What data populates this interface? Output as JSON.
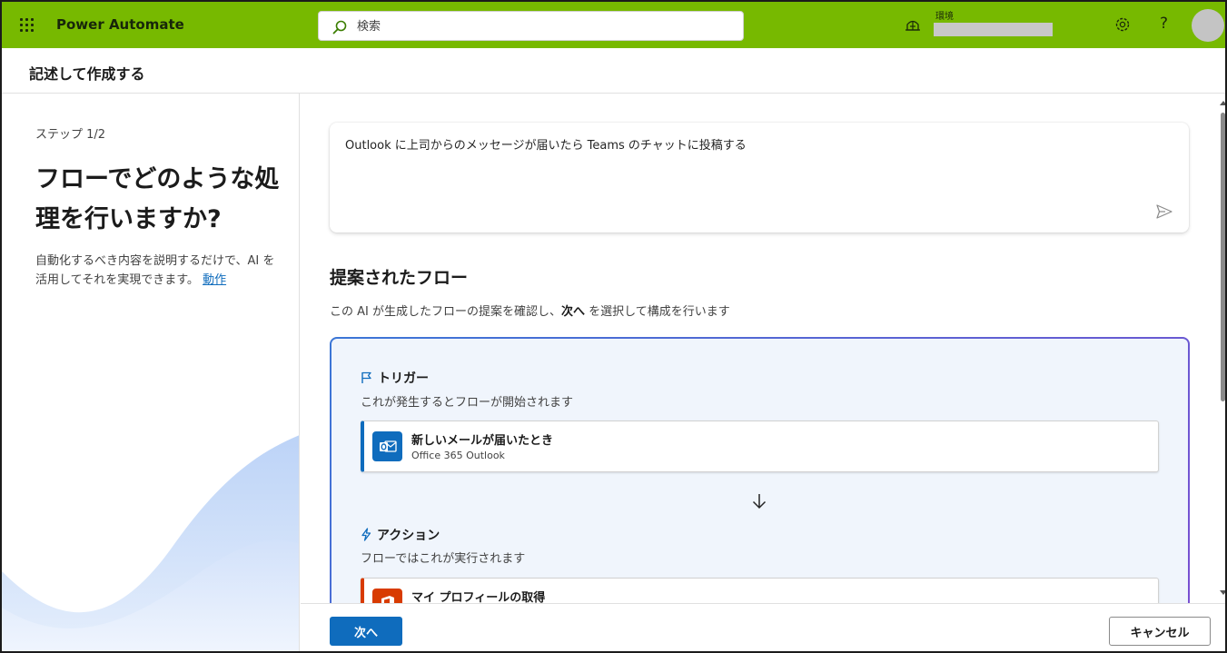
{
  "header": {
    "app_name": "Power Automate",
    "search_placeholder": "検索",
    "environment_label": "環境",
    "brand_color": "#77b900",
    "icons": [
      "waffle-icon",
      "search-icon",
      "environment-icon",
      "settings-gear-icon",
      "help-icon",
      "avatar"
    ]
  },
  "page": {
    "title": "記述して作成する"
  },
  "left_panel": {
    "step": "ステップ 1/2",
    "heading": "フローでどのような処理を行いますか?",
    "description": "自動化するべき内容を説明するだけで、AI を活用してそれを実現できます。",
    "link": "動作"
  },
  "prompt": {
    "text": "Outlook に上司からのメッセージが届いたら Teams のチャットに投稿する"
  },
  "suggestion": {
    "title": "提案されたフロー",
    "subtitle_pre": "この AI が生成したフローの提案を確認し、",
    "subtitle_bold": "次へ",
    "subtitle_post": " を選択して構成を行います",
    "trigger": {
      "label": "トリガー",
      "description": "これが発生するとフローが開始されます",
      "step_name": "新しいメールが届いたとき",
      "app": "Office 365 Outlook"
    },
    "action": {
      "label": "アクション",
      "description": "フローではこれが実行されます",
      "step_name": "マイ プロフィールの取得"
    }
  },
  "footer": {
    "next_label": "次へ",
    "cancel_label": "キャンセル"
  }
}
